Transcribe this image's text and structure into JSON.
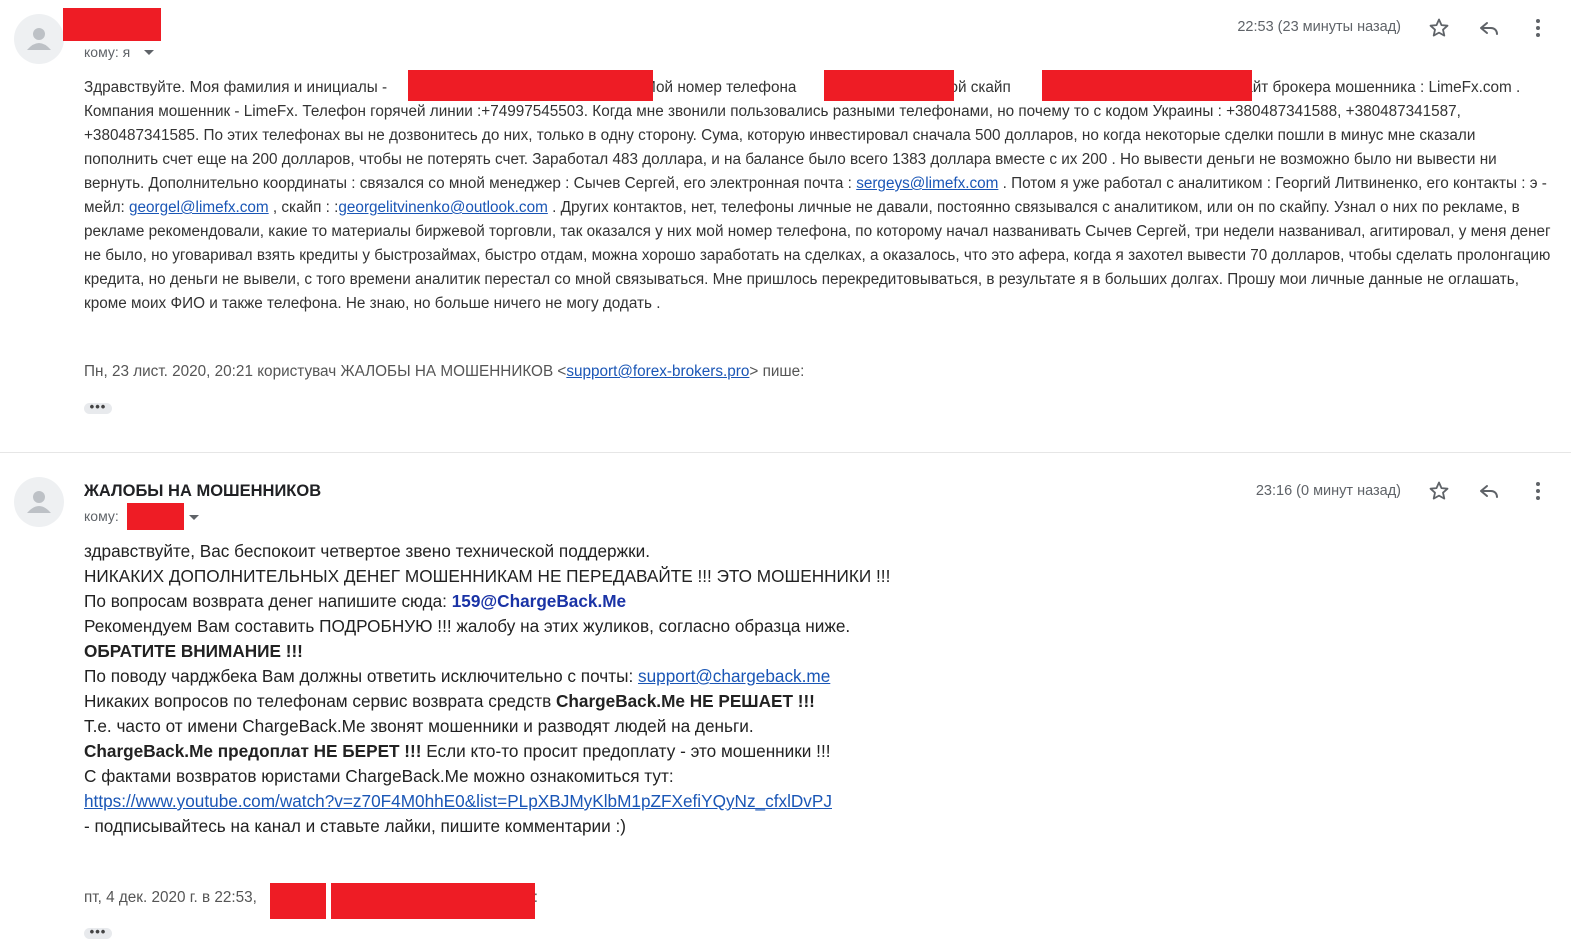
{
  "message1": {
    "to_label": "кому: я",
    "time": "22:53 (23 минуты назад)",
    "body": {
      "p1": "Здравствуйте. Моя фамилия и инициалы -",
      "p2": "Мой номер телефона",
      "p3": ", мой скайп",
      "p4": "Сайт брокера мошенника : LimeFx.com . Компания мошенник - LimeFx. Телефон горячей линии :+74997545503. Когда мне звонили пользовались разными телефонами, но почему то с кодом Украины : +380487341588, +380487341587, +380487341585. По этих телефонах вы не дозвонитесь до них, только в одну сторону. Сума, которую инвестировал сначала 500 долларов, но когда некоторые сделки пошли в минус мне сказали пополнить счет еще на 200 долларов, чтобы не потерять счет. Заработал 483 доллара, и на балансе было всего 1383 доллара вместе с их 200 . Но вывести деньги не возможно было ни вывести ни вернуть. Дополнительно координаты : связался со мной менеджер : Сычев Сергей, его электронная почта :",
      "link1": "sergeys@limefx.com",
      "p5": ". Потом я уже работал с аналитиком : Георгий Литвиненко, его контакты : э - мейл:",
      "link2": "georgel@limefx.com",
      "p6": ", скайп : :",
      "link3": "georgelitvinenko@outlook.com",
      "p7": ". Других контактов, нет, телефоны личные не давали, постоянно связывался с аналитиком, или он по скайпу. Узнал о них по рекламе, в рекламе рекомендовали, какие то материалы биржевой торговли, так оказался у них мой номер телефона, по которому начал названивать Сычев Сергей, три недели названивал, агитировал, у меня денег не было, но уговаривал взять кредиты у быстрозаймах, быстро отдам, можна хорошо заработать на сделках, а оказалось, что это афера, когда я захотел вывести 70 долларов, чтобы сделать пролонгацию кредита, но деньги не вывели, с того времени аналитик перестал со мной связываться. Мне пришлось перекредитовываться, в результате я в больших долгах. Прошу мои личные данные не оглашать, кроме моих ФИО и также телефона. Не знаю, но больше ничего не могу додать ."
    },
    "quote": {
      "prefix": "Пн, 23 лист. 2020, 20:21 користувач ЖАЛОБЫ НА МОШЕННИКОВ <",
      "email": "support@forex-brokers.pro",
      "suffix": "> пише:"
    },
    "ellipsis": "•••"
  },
  "message2": {
    "sender": "ЖАЛОБЫ НА МОШЕННИКОВ",
    "to_label": "кому:",
    "time": "23:16 (0 минут назад)",
    "lines": {
      "l1": "здравствуйте, Вас беспокоит четвертое звено технической поддержки.",
      "l2": "НИКАКИХ ДОПОЛНИТЕЛЬНЫХ ДЕНЕГ МОШЕННИКАМ НЕ ПЕРЕДАВАЙТЕ !!! ЭТО МОШЕННИКИ !!!",
      "l3_prefix": "По вопросам возврата денег напишите сюда: ",
      "l3_email": "159@ChargeBack.Me",
      "l4": "Рекомендуем Вам составить ПОДРОБНУЮ !!! жалобу на этих жуликов, согласно образца ниже.",
      "l5": "ОБРАТИТЕ ВНИМАНИЕ !!!",
      "l6_prefix": "По поводу чарджбека Вам должны ответить исключительно с почты: ",
      "l6_email": "support@chargeback.me",
      "l7_prefix": "Никаких вопросов по телефонам сервис возврата средств ",
      "l7_bold": "ChargeBack.Me НЕ РЕШАЕТ !!!",
      "l8": "Т.е. часто от имени ChargeBack.Me звонят мошенники и разводят людей на деньги.",
      "l9_bold": "ChargeBack.Me предоплат НЕ БЕРЕТ !!!",
      "l9_rest": " Если кто-то просит предоплату - это мошенники !!!",
      "l10": "С фактами возвратов юристами ChargeBack.Me можно ознакомиться тут:",
      "l11_link": "https://www.youtube.com/watch?v=z70F4M0hhE0&list=PLpXBJMyKlbM1pZFXefiYQyNz_cfxlDvPJ",
      "l12": " - подписывайтесь на канал и ставьте лайки, пишите комментарии :)"
    },
    "quote": {
      "prefix": "пт, 4 дек. 2020 г. в 22:53,",
      "suffix": ">:"
    },
    "ellipsis": "•••"
  },
  "colors": {
    "redaction": "#ee1c25",
    "link": "#1a56b6",
    "email_highlight": "#1a33a6",
    "muted_text": "#5f6368"
  },
  "icons": [
    "avatar-icon",
    "star-icon",
    "reply-icon",
    "more-vert-icon",
    "caret-down-icon"
  ]
}
